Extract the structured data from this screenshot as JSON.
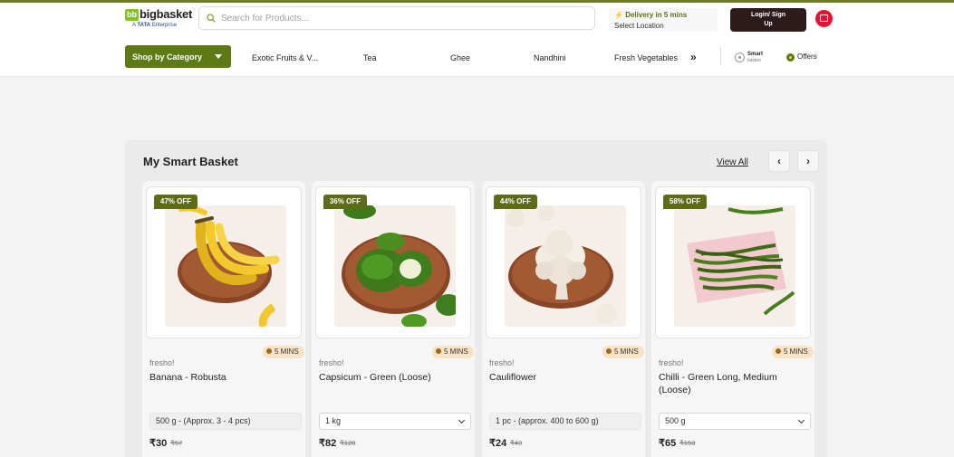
{
  "header": {
    "logo_text": "bigbasket",
    "logo_sub_prefix": "A",
    "logo_sub_brand": "TATA",
    "logo_sub_suffix": "Enterprise",
    "search_placeholder": "Search for Products...",
    "delivery_time": "Delivery in 5 mins",
    "delivery_location": "Select Location",
    "login_label_line1": "Login/ Sign",
    "login_label_line2": "Up"
  },
  "nav": {
    "shop_by_category": "Shop by Category",
    "items": [
      "Exotic Fruits & V...",
      "Tea",
      "Ghee",
      "Nandhini",
      "Fresh Vegetables"
    ],
    "more": "»",
    "smart_basket_line1": "Smart",
    "smart_basket_line2": "basket",
    "offers": "Offers"
  },
  "section": {
    "title": "My Smart Basket",
    "view_all": "View All",
    "prev": "‹",
    "next": "›"
  },
  "products": [
    {
      "discount": "47% OFF",
      "delivery": "5 MINS",
      "brand": "fresho!",
      "name": "Banana - Robusta",
      "quantity": "500 g - (Approx. 3 - 4 pcs)",
      "price": "₹30",
      "mrp": "₹57"
    },
    {
      "discount": "36% OFF",
      "delivery": "5 MINS",
      "brand": "fresho!",
      "name": "Capsicum - Green (Loose)",
      "quantity": "1 kg",
      "price": "₹82",
      "mrp": "₹128"
    },
    {
      "discount": "44% OFF",
      "delivery": "5 MINS",
      "brand": "fresho!",
      "name": "Cauliflower",
      "quantity": "1 pc - (approx. 400 to 600 g)",
      "price": "₹24",
      "mrp": "₹43"
    },
    {
      "discount": "58% OFF",
      "delivery": "5 MINS",
      "brand": "fresho!",
      "name": "Chilli - Green Long, Medium (Loose)",
      "quantity": "500 g",
      "price": "₹65",
      "mrp": "₹153"
    }
  ],
  "colors": {
    "brand_green": "#5d7a14",
    "discount_badge": "#5d6c17",
    "login_button": "#2d1a1a",
    "cart_red": "#e3142f",
    "delivery_pill": "#f9e3c5"
  }
}
